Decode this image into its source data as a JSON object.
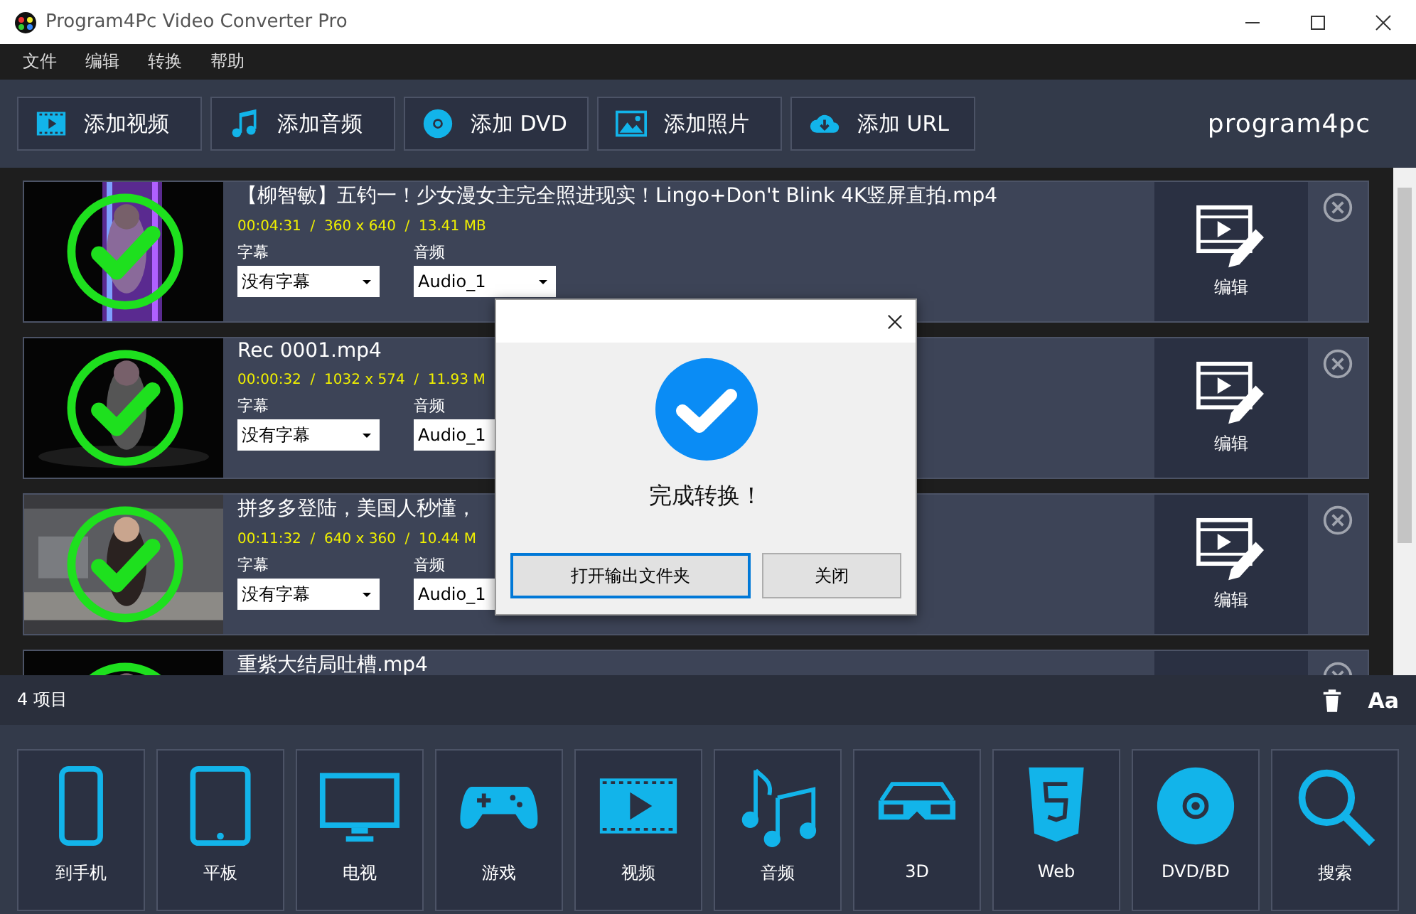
{
  "window": {
    "title": "Program4Pc Video Converter Pro"
  },
  "menu": [
    "文件",
    "编辑",
    "转换",
    "帮助"
  ],
  "toolbar": [
    {
      "kind": "video",
      "label": "添加视频"
    },
    {
      "kind": "audio",
      "label": "添加音频"
    },
    {
      "kind": "dvd",
      "label": "添加 DVD"
    },
    {
      "label": "添加照片"
    },
    {
      "kind": "url",
      "label": "添加 URL"
    }
  ],
  "logo": "program4pc",
  "items": [
    {
      "title": "【柳智敏】五钓一！少女漫女主完全照进现实！Lingo+Don't Blink 4K竖屏直拍.mp4",
      "meta": "00:04:31  /  360 x 640  /  13.41 MB",
      "subtitle_label": "字幕",
      "subtitle": "没有字幕",
      "audio_label": "音频",
      "audio": "Audio_1",
      "edit": "编辑",
      "done": true
    },
    {
      "title": "Rec 0001.mp4",
      "meta": "00:00:32  /  1032 x 574  /  11.93 M",
      "subtitle_label": "字幕",
      "subtitle": "没有字幕",
      "audio_label": "音频",
      "audio": "Audio_1",
      "edit": "编辑",
      "done": true
    },
    {
      "title": "拼多多登陆，美国人秒懂，",
      "meta": "00:11:32  /  640 x 360  /  10.44 M",
      "subtitle_label": "字幕",
      "subtitle": "没有字幕",
      "audio_label": "音频",
      "audio": "Audio_1",
      "edit": "编辑",
      "done": true
    },
    {
      "title": "重紫大结局吐槽.mp4",
      "done": true
    }
  ],
  "status": {
    "count": "4 项目",
    "font_button": "Aa"
  },
  "categories": [
    {
      "kind": "phone",
      "label": "到手机"
    },
    {
      "kind": "tablet",
      "label": "平板"
    },
    {
      "kind": "tv",
      "label": "电视"
    },
    {
      "kind": "game",
      "label": "游戏"
    },
    {
      "kind": "video",
      "label": "视频"
    },
    {
      "kind": "music",
      "label": "音频"
    },
    {
      "kind": "glasses",
      "label": "3D"
    },
    {
      "kind": "html5",
      "label": "Web"
    },
    {
      "kind": "disc",
      "label": "DVD/BD"
    },
    {
      "kind": "search",
      "label": "搜索"
    }
  ],
  "dialog": {
    "message": "完成转换！",
    "buttons": [
      {
        "label": "打开输出文件夹",
        "selected": true
      },
      {
        "label": "关闭",
        "selected": false
      }
    ]
  }
}
